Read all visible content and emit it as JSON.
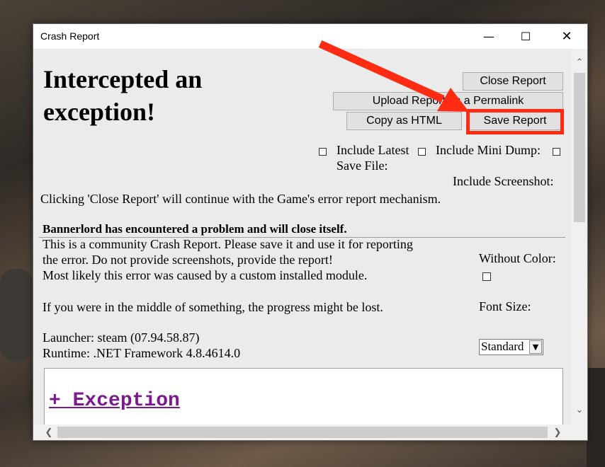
{
  "window": {
    "title": "Crash Report",
    "minimize_icon": "minimize-icon",
    "maximize_icon": "maximize-icon",
    "close_icon": "close-icon"
  },
  "header": {
    "title_line1": "Intercepted an",
    "title_line2": "exception!"
  },
  "buttons": {
    "close_report": "Close Report",
    "upload_report": "Upload Report as a Permalink",
    "copy_html": "Copy as HTML",
    "save_report": "Save Report"
  },
  "options": {
    "include_latest": "Include Latest",
    "save_file": "Save File:",
    "include_mini_dump": "Include Mini Dump:",
    "include_screenshot": "Include Screenshot:",
    "without_color": "Without Color:",
    "font_size": "Font Size:",
    "font_size_value": "Standard"
  },
  "notice": "Clicking 'Close Report' will continue with the Game's error report mechanism.",
  "message": {
    "bold": "Bannerlord has encountered a problem and will close itself.",
    "line1": "This is a community Crash Report. Please save it and use it for reporting",
    "line2": "the error. Do not provide screenshots, provide the report!",
    "line3": "Most likely this error was caused by a custom installed module.",
    "line4": "If you were in the middle of something, the progress might be lost.",
    "launcher": "Launcher: steam (07.94.58.87)",
    "runtime": "Runtime: .NET Framework 4.8.4614.0"
  },
  "exception": {
    "label": "+ Exception"
  },
  "colors": {
    "annotation": "#ff2b12",
    "link": "#7a1a8c"
  }
}
